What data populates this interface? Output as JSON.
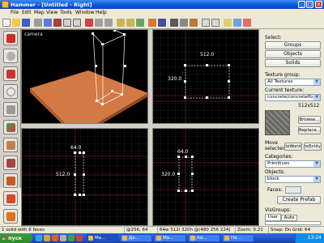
{
  "window": {
    "title": "Hammer - [Untitled - Right]"
  },
  "window_buttons": {
    "minimize": "_",
    "maximize": "□",
    "close": "×"
  },
  "menu": [
    "File",
    "Edit",
    "Map",
    "View",
    "Tools",
    "Window",
    "Help"
  ],
  "viewports": {
    "camera": {
      "label": "camera"
    },
    "top": {
      "width_label": "512.0",
      "height_label": "320.0"
    },
    "front": {
      "width_label": "64.0",
      "height_label": "512.0"
    },
    "side": {
      "width_label": "64.0",
      "height_label": "320.0"
    }
  },
  "panel": {
    "select_label": "Select:",
    "groups_button": "Groups",
    "objects_button": "Objects",
    "solids_button": "Solids",
    "texture_group_label": "Texture group:",
    "texture_group_value": "All Textures",
    "current_texture_label": "Current texture:",
    "current_texture_value": "concrete/concretefloor",
    "texture_size": "512x512",
    "browse_button": "Browse...",
    "replace_button": "Replace...",
    "move_selected_label": "Move selected:",
    "to_world_button": "toWorld",
    "to_entity_button": "toEntity",
    "categories_label": "Categories:",
    "categories_value": "Primitives",
    "objects_label": "Objects:",
    "objects_value": "block",
    "faces_label": "Faces:",
    "create_prefab_button": "Create Prefab",
    "visgroups_label": "VisGroups:",
    "visgroups_tabs": [
      "User",
      "Auto"
    ]
  },
  "status": {
    "selection": "1 solid with 6 faces",
    "coords": "@256, 64",
    "size": "64w 512l 320h @(480 256 224)",
    "zoom": "Zoom: 0.21",
    "snap": "Snap: On Grid: 64"
  },
  "taskbar": {
    "start": "пуск",
    "tasks": [
      "Ма...",
      "До...",
      "Ма...",
      "Ad...",
      "На..."
    ],
    "clock": "13:24"
  }
}
